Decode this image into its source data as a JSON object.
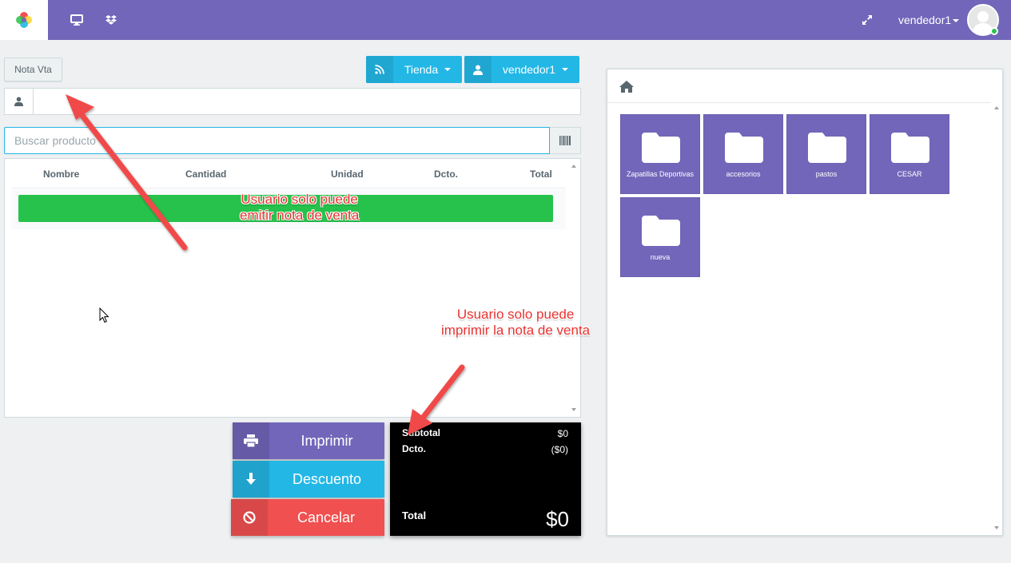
{
  "topbar": {
    "user_name": "vendedor1",
    "icons": [
      "logo-icon",
      "desktop-icon",
      "dropbox-icon",
      "expand-icon"
    ],
    "accent": "#7266ba"
  },
  "toolbar": {
    "doc_type": "Nota Vta",
    "store_label": "Tienda",
    "seller_label": "vendedor1"
  },
  "client": {
    "value": ""
  },
  "search": {
    "placeholder": "Buscar producto"
  },
  "table": {
    "columns": [
      "Nombre",
      "Cantidad",
      "Unidad",
      "Dcto.",
      "Total"
    ],
    "rows": []
  },
  "actions": {
    "print_label": "Imprimir",
    "discount_label": "Descuento",
    "cancel_label": "Cancelar",
    "colors": {
      "print": "#7266ba",
      "discount": "#23b7e5",
      "cancel": "#f05050"
    }
  },
  "totals": {
    "subtotal_label": "Subtotal",
    "subtotal_value": "$0",
    "discount_label": "Dcto.",
    "discount_value": "($0)",
    "total_label": "Total",
    "total_value": "$0"
  },
  "categories": {
    "home_icon": "home-icon",
    "items": [
      {
        "name": "Zapatillas Deportivas"
      },
      {
        "name": "accesorios"
      },
      {
        "name": "pastos"
      },
      {
        "name": "CESAR"
      },
      {
        "name": "nueva"
      }
    ]
  },
  "annotations": {
    "note1_line1": "Usuario solo puede",
    "note1_line2": "emitir nota de venta",
    "note2_line1": "Usuario solo puede",
    "note2_line2": "imprimir la nota de venta"
  }
}
